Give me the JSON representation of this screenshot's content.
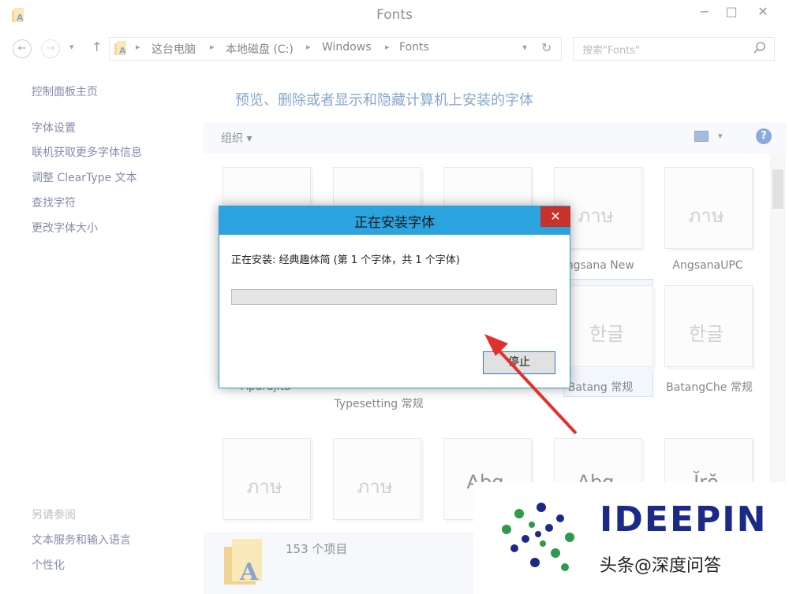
{
  "window": {
    "title": "Fonts"
  },
  "nav": {
    "breadcrumbs": [
      "这台电脑",
      "本地磁盘 (C:)",
      "Windows",
      "Fonts"
    ],
    "search_placeholder": "搜索\"Fonts\""
  },
  "left_pane": {
    "links": [
      "控制面板主页",
      "字体设置",
      "联机获取更多字体信息",
      "调整 ClearType 文本",
      "查找字符",
      "更改字体大小"
    ],
    "see_also_title": "另请参阅",
    "see_also": [
      "文本服务和输入语言",
      "个性化"
    ]
  },
  "main": {
    "heading": "预览、删除或者显示和隐藏计算机上安装的字体",
    "organize_label": "组织 ▾",
    "tiles_row1": [
      {
        "glyph": "",
        "label": ""
      },
      {
        "glyph": "",
        "label": ""
      },
      {
        "glyph": "",
        "label": ""
      },
      {
        "glyph": "ภาษ",
        "label": "Angsana New"
      },
      {
        "glyph": "ภาษ",
        "label": "AngsanaUPC"
      }
    ],
    "tiles_row2": [
      {
        "glyph": "",
        "label": "Aparajita"
      },
      {
        "glyph": "",
        "label": "Typesetting 常规"
      },
      {
        "glyph": "",
        "label": ""
      },
      {
        "glyph": "한글",
        "label": "Batang 常规"
      },
      {
        "glyph": "한글",
        "label": "BatangChe 常规"
      }
    ],
    "tiles_row3": [
      {
        "glyph": "ภาษ"
      },
      {
        "glyph": "ภาษ"
      },
      {
        "glyph": "Abg"
      },
      {
        "glyph": "Abg"
      },
      {
        "glyph": "Ĭrŏ"
      }
    ]
  },
  "status": {
    "count_text": "153 个项目"
  },
  "dialog": {
    "title": "正在安装字体",
    "message": "正在安装: 经典趣体简 (第 1 个字体，共 1 个字体)",
    "progress": 0.0,
    "stop_label": "停止"
  },
  "watermark": {
    "brand": "IDEEPIN",
    "caption": "头条@深度问答"
  },
  "colors": {
    "accent": "#2ba3df",
    "close": "#c8322b",
    "heading": "#1f5fa8"
  }
}
